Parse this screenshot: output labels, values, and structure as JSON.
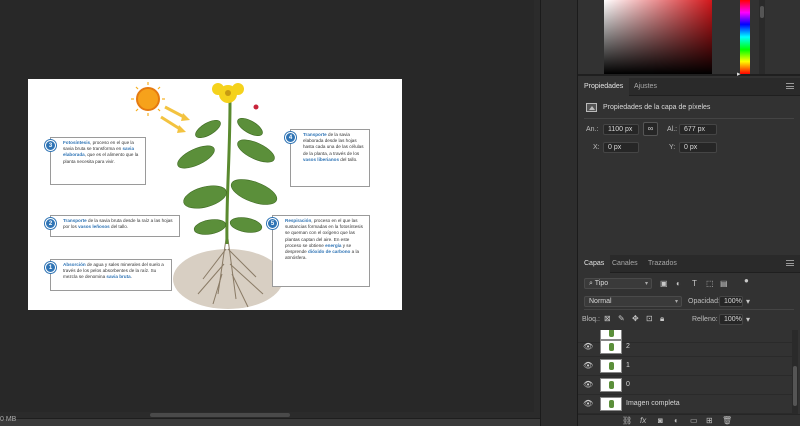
{
  "status_bar": {
    "doc_size": "0 MB"
  },
  "document": {
    "callouts": [
      {
        "num": "3",
        "text_before": "",
        "highlight": "Fotosíntesis",
        "text_after": ", proceso en el que la savia bruta se transforma en ",
        "highlight2": "savia elaborada",
        "text_after2": ", que es el alimento que la planta necesita para vivir."
      },
      {
        "num": "4",
        "text_before": "",
        "highlight": "Transporte",
        "text_after": " de la savia elaborada desde las hojas hasta cada una de las células de la planta, a través de los ",
        "highlight2": "vasos liberianos",
        "text_after2": " del tallo."
      },
      {
        "num": "2",
        "text_before": "",
        "highlight": "Transporte",
        "text_after": " de la savia bruta desde la raíz a las hojas por los ",
        "highlight2": "vasos leñosos",
        "text_after2": " del tallo."
      },
      {
        "num": "5",
        "text_before": "",
        "highlight": "Respiración",
        "text_after": ", proceso en el que las sustancias formadas en la fotosíntesis se queman con el oxígeno que las plantas captan del aire. En este proceso se obtiene ",
        "highlight2": "energía",
        "text_after2": " y se desprende ",
        "highlight3": "dióxido de carbono",
        "text_after3": " a la atmósfera."
      },
      {
        "num": "1",
        "text_before": "",
        "highlight": "Absorción",
        "text_after": " de agua y sales minerales del suelo a través de los pelos absorbentes de la raíz. Su mezcla se denomina ",
        "highlight2": "savia bruta",
        "text_after2": "."
      }
    ]
  },
  "properties_panel": {
    "tabs": [
      "Propiedades",
      "Ajustes"
    ],
    "title": "Propiedades de la capa de píxeles",
    "width_label": "An.:",
    "width_value": "1100 px",
    "height_label": "Al.:",
    "height_value": "677 px",
    "x_label": "X:",
    "x_value": "0 px",
    "y_label": "Y:",
    "y_value": "0 px"
  },
  "layers_panel": {
    "tabs": [
      "Capas",
      "Canales",
      "Trazados"
    ],
    "filter_label": "Tipo",
    "blend_mode": "Normal",
    "opacity_label": "Opacidad:",
    "opacity_value": "100%",
    "lock_label": "Bloq.:",
    "fill_label": "Relleno:",
    "fill_value": "100%",
    "layers": [
      {
        "name": "2"
      },
      {
        "name": "1"
      },
      {
        "name": "0"
      },
      {
        "name": "Imagen completa"
      }
    ]
  },
  "colors": {
    "accent_blue": "#2f74b5",
    "picker_base": "#d2171b",
    "leaf_green": "#5b8f3a",
    "flower_yellow": "#f5d21c"
  }
}
